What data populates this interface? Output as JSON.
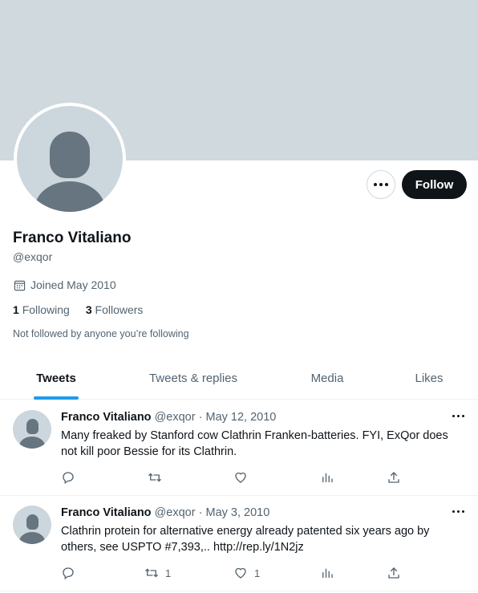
{
  "profile": {
    "name": "Franco Vitaliano",
    "handle": "@exqor",
    "joined": "Joined May 2010",
    "following_count": "1",
    "following_label": "Following",
    "followers_count": "3",
    "followers_label": "Followers",
    "not_followed": "Not followed by anyone you’re following",
    "follow_label": "Follow"
  },
  "tabs": [
    {
      "label": "Tweets",
      "active": true
    },
    {
      "label": "Tweets & replies",
      "active": false
    },
    {
      "label": "Media",
      "active": false
    },
    {
      "label": "Likes",
      "active": false
    }
  ],
  "tweets": [
    {
      "name": "Franco Vitaliano",
      "handle": "@exqor",
      "date": "May 12, 2010",
      "text": "Many freaked by Stanford cow Clathrin Franken-batteries. FYI, ExQor does not kill poor Bessie for its Clathrin.",
      "retweets": "",
      "likes": ""
    },
    {
      "name": "Franco Vitaliano",
      "handle": "@exqor",
      "date": "May 3, 2010",
      "text": "Clathrin protein for alternative energy already patented six years ago by others, see USPTO #7,393,.. http://rep.ly/1N2jz",
      "retweets": "1",
      "likes": "1"
    }
  ],
  "colors": {
    "banner": "#cfd9de",
    "accent": "#1d9bf0",
    "follow_button": "#0f1419",
    "secondary_text": "#536471"
  }
}
